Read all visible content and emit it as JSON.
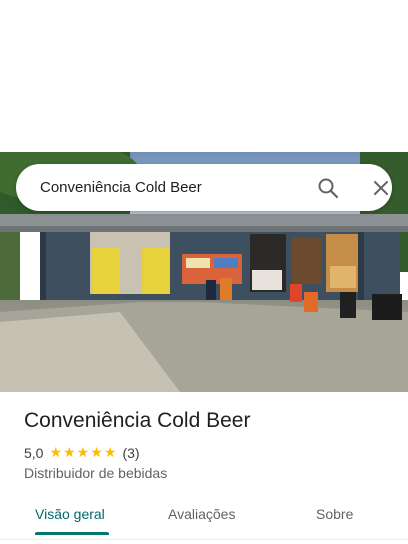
{
  "search": {
    "query": "Conveniência Cold Beer"
  },
  "place": {
    "name": "Conveniência Cold Beer",
    "rating_text": "5,0",
    "rating_value": 5.0,
    "stars": [
      "★",
      "★",
      "★",
      "★",
      "★"
    ],
    "review_count": "(3)",
    "category": "Distribuidor de bebidas"
  },
  "tabs": [
    {
      "label": "Visão geral",
      "active": true
    },
    {
      "label": "Avaliações",
      "active": false
    },
    {
      "label": "Sobre",
      "active": false
    }
  ],
  "icons": {
    "search": "search-icon",
    "close": "close-icon"
  },
  "colors": {
    "accent": "#00796b",
    "star": "#fbbc04"
  }
}
